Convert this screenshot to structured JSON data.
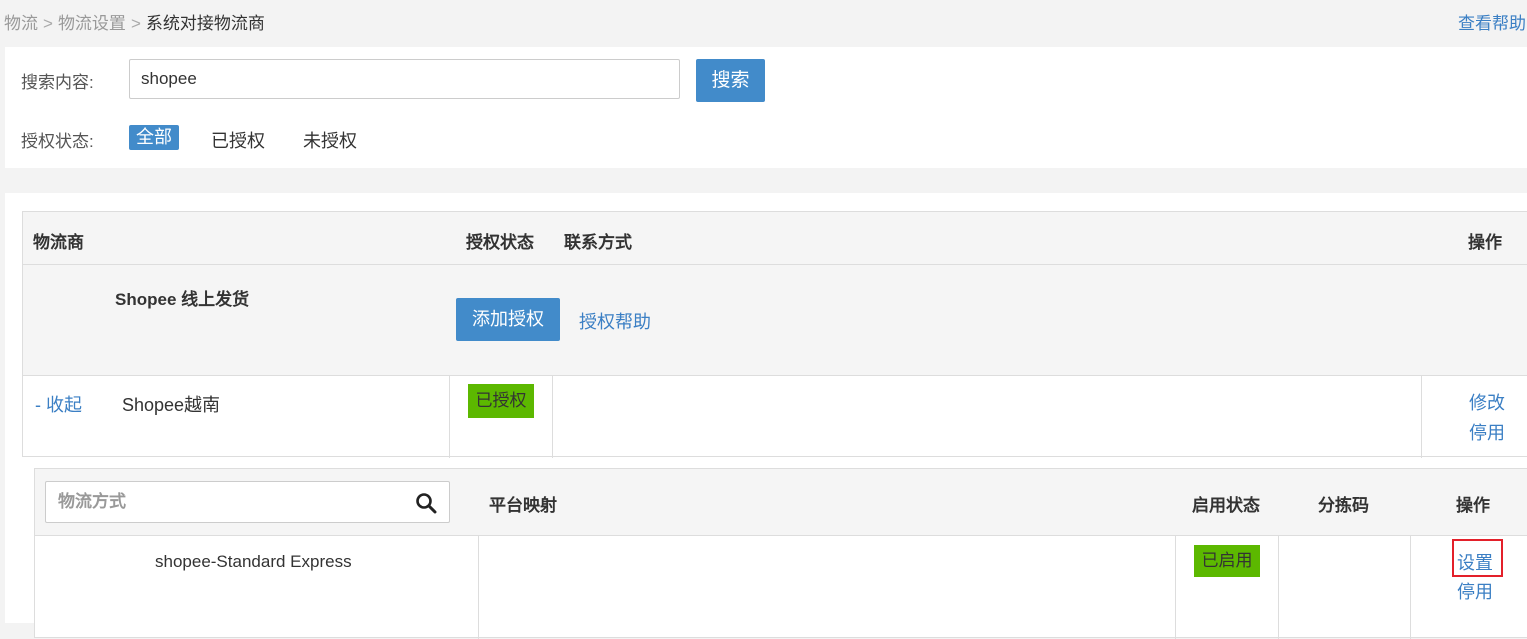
{
  "breadcrumb": {
    "items": [
      "物流",
      "物流设置",
      "系统对接物流商"
    ],
    "separator": ">"
  },
  "help_link": "查看帮助",
  "search": {
    "label": "搜索内容:",
    "value": "shopee",
    "button": "搜索"
  },
  "auth_filter": {
    "label": "授权状态:",
    "options": [
      "全部",
      "已授权",
      "未授权"
    ],
    "selected": "全部"
  },
  "table": {
    "headers": {
      "carrier": "物流商",
      "auth_status": "授权状态",
      "contact": "联系方式",
      "actions": "操作"
    },
    "group": {
      "title": "Shopee 线上发货",
      "add_auth_button": "添加授权",
      "auth_help_link": "授权帮助"
    },
    "carrier_row": {
      "collapse": "- 收起",
      "name": "Shopee越南",
      "status": "已授权",
      "contact": "",
      "actions": [
        "修改",
        "停用"
      ]
    }
  },
  "sub_table": {
    "method_placeholder": "物流方式",
    "headers": {
      "mapping": "平台映射",
      "enabled_status": "启用状态",
      "sort_code": "分拣码",
      "actions": "操作"
    },
    "rows": [
      {
        "name": "shopee-Standard Express",
        "mapping": "",
        "status": "已启用",
        "sort_code": "",
        "actions": [
          "设置",
          "停用"
        ]
      }
    ]
  },
  "colors": {
    "primary": "#428bca",
    "link": "#3b7fc4",
    "status_green": "#5cb800",
    "highlight_red": "#e3202a"
  }
}
